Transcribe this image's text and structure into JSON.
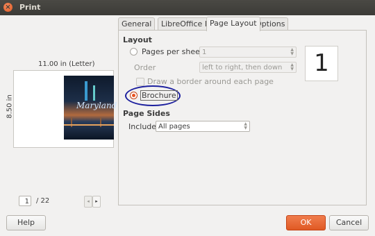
{
  "window": {
    "title": "Print",
    "close_glyph": "×"
  },
  "preview": {
    "paper_width_label": "11.00 in (Letter)",
    "paper_height_label": "8.50 in",
    "cover_title": "Maryland",
    "page_current": "1",
    "page_total": "/ 22",
    "prev_glyph": "◂",
    "next_glyph": "▸"
  },
  "tabs": [
    {
      "label": "General",
      "active": false
    },
    {
      "label": "LibreOffice Draw",
      "active": false
    },
    {
      "label": "Page Layout",
      "active": true
    },
    {
      "label": "Options",
      "active": false
    }
  ],
  "layout": {
    "heading": "Layout",
    "pages_per_sheet_label": "Pages per sheet",
    "pages_per_sheet_value": "1",
    "order_label": "Order",
    "order_value": "left to right, then down",
    "border_label": "Draw a border around each page",
    "brochure_label": "Brochure",
    "preview_number": "1"
  },
  "page_sides": {
    "heading": "Page Sides",
    "include_label": "Include",
    "include_value": "All pages"
  },
  "buttons": {
    "help": "Help",
    "ok": "OK",
    "cancel": "Cancel"
  },
  "colors": {
    "accent": "#e95420",
    "highlight_ring": "#1c1f9e"
  }
}
